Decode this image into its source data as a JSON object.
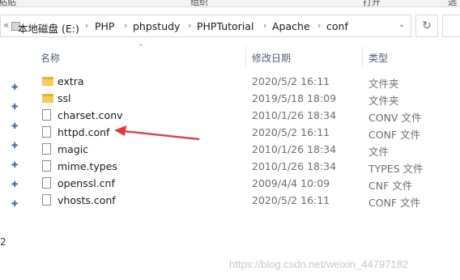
{
  "ribbon": {
    "labels": [
      "粘贴",
      "组织",
      "打开",
      "选"
    ]
  },
  "address": {
    "nav_chevron": "«",
    "crumbs": [
      "本地磁盘 (E:)",
      "PHP",
      "phpstudy",
      "PHPTutorial",
      "Apache",
      "conf"
    ],
    "separator": "›",
    "dropdown": "⌄",
    "refresh": "↻"
  },
  "columns": {
    "name": "名称",
    "date": "修改日期",
    "type": "类型"
  },
  "sidebar": {
    "pins": [
      "✚",
      "✚",
      "✚",
      "✚",
      "✚",
      "✚",
      "✚"
    ],
    "number": "2"
  },
  "files": [
    {
      "name": "extra",
      "date": "2020/5/2 16:11",
      "type": "文件夹",
      "icon": "folder-icon"
    },
    {
      "name": "ssl",
      "date": "2019/5/18 18:09",
      "type": "文件夹",
      "icon": "folder-icon"
    },
    {
      "name": "charset.conv",
      "date": "2010/1/26 18:34",
      "type": "CONV 文件",
      "icon": "file-icon"
    },
    {
      "name": "httpd.conf",
      "date": "2020/5/2 16:11",
      "type": "CONF 文件",
      "icon": "file-icon"
    },
    {
      "name": "magic",
      "date": "2010/1/26 18:34",
      "type": "文件",
      "icon": "file-icon"
    },
    {
      "name": "mime.types",
      "date": "2010/1/26 18:34",
      "type": "TYPES 文件",
      "icon": "file-icon"
    },
    {
      "name": "openssl.cnf",
      "date": "2009/4/4 10:09",
      "type": "CNF 文件",
      "icon": "file-icon"
    },
    {
      "name": "vhosts.conf",
      "date": "2020/5/2 16:11",
      "type": "CONF 文件",
      "icon": "file-icon"
    }
  ],
  "annotation": {
    "arrow_color": "#e0383a",
    "points_to": "httpd.conf"
  },
  "watermark": "https://blog.csdn.net/weixin_44797182"
}
